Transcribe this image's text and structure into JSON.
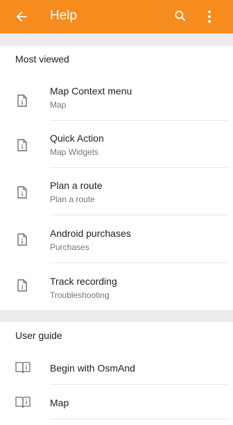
{
  "appbar": {
    "title": "Help",
    "back_icon": "arrow-left-icon",
    "search_icon": "search-icon",
    "more_icon": "more-vert-icon",
    "color": "#f68c1d"
  },
  "most_viewed": {
    "title": "Most viewed",
    "items": [
      {
        "title": "Map Context menu",
        "subtitle": "Map"
      },
      {
        "title": "Quick Action",
        "subtitle": "Map Widgets"
      },
      {
        "title": "Plan a route",
        "subtitle": "Plan a route"
      },
      {
        "title": "Android purchases",
        "subtitle": "Purchases"
      },
      {
        "title": "Track recording",
        "subtitle": "Troubleshooting"
      }
    ]
  },
  "user_guide": {
    "title": "User guide",
    "items": [
      {
        "title": "Begin with OsmAnd"
      },
      {
        "title": "Map"
      }
    ]
  }
}
